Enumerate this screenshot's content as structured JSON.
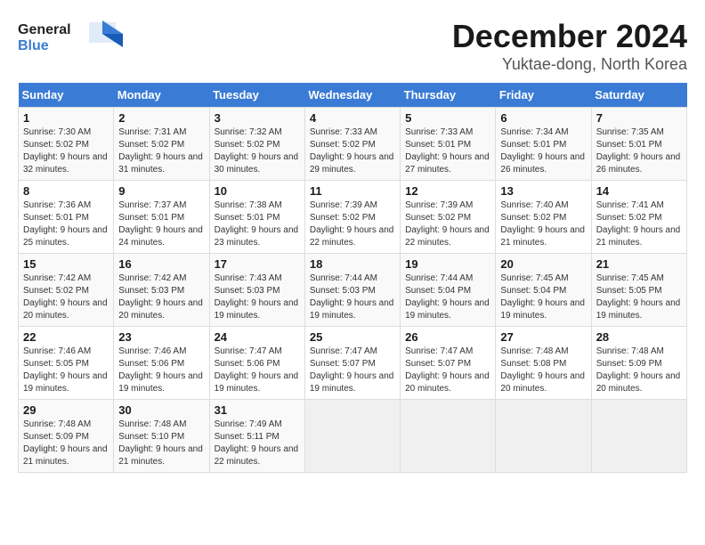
{
  "logo": {
    "line1": "General",
    "line2": "Blue"
  },
  "title": "December 2024",
  "subtitle": "Yuktae-dong, North Korea",
  "days_of_week": [
    "Sunday",
    "Monday",
    "Tuesday",
    "Wednesday",
    "Thursday",
    "Friday",
    "Saturday"
  ],
  "weeks": [
    [
      {
        "day": "1",
        "info": "Sunrise: 7:30 AM\nSunset: 5:02 PM\nDaylight: 9 hours and 32 minutes."
      },
      {
        "day": "2",
        "info": "Sunrise: 7:31 AM\nSunset: 5:02 PM\nDaylight: 9 hours and 31 minutes."
      },
      {
        "day": "3",
        "info": "Sunrise: 7:32 AM\nSunset: 5:02 PM\nDaylight: 9 hours and 30 minutes."
      },
      {
        "day": "4",
        "info": "Sunrise: 7:33 AM\nSunset: 5:02 PM\nDaylight: 9 hours and 29 minutes."
      },
      {
        "day": "5",
        "info": "Sunrise: 7:33 AM\nSunset: 5:01 PM\nDaylight: 9 hours and 27 minutes."
      },
      {
        "day": "6",
        "info": "Sunrise: 7:34 AM\nSunset: 5:01 PM\nDaylight: 9 hours and 26 minutes."
      },
      {
        "day": "7",
        "info": "Sunrise: 7:35 AM\nSunset: 5:01 PM\nDaylight: 9 hours and 26 minutes."
      }
    ],
    [
      {
        "day": "8",
        "info": "Sunrise: 7:36 AM\nSunset: 5:01 PM\nDaylight: 9 hours and 25 minutes."
      },
      {
        "day": "9",
        "info": "Sunrise: 7:37 AM\nSunset: 5:01 PM\nDaylight: 9 hours and 24 minutes."
      },
      {
        "day": "10",
        "info": "Sunrise: 7:38 AM\nSunset: 5:01 PM\nDaylight: 9 hours and 23 minutes."
      },
      {
        "day": "11",
        "info": "Sunrise: 7:39 AM\nSunset: 5:02 PM\nDaylight: 9 hours and 22 minutes."
      },
      {
        "day": "12",
        "info": "Sunrise: 7:39 AM\nSunset: 5:02 PM\nDaylight: 9 hours and 22 minutes."
      },
      {
        "day": "13",
        "info": "Sunrise: 7:40 AM\nSunset: 5:02 PM\nDaylight: 9 hours and 21 minutes."
      },
      {
        "day": "14",
        "info": "Sunrise: 7:41 AM\nSunset: 5:02 PM\nDaylight: 9 hours and 21 minutes."
      }
    ],
    [
      {
        "day": "15",
        "info": "Sunrise: 7:42 AM\nSunset: 5:02 PM\nDaylight: 9 hours and 20 minutes."
      },
      {
        "day": "16",
        "info": "Sunrise: 7:42 AM\nSunset: 5:03 PM\nDaylight: 9 hours and 20 minutes."
      },
      {
        "day": "17",
        "info": "Sunrise: 7:43 AM\nSunset: 5:03 PM\nDaylight: 9 hours and 19 minutes."
      },
      {
        "day": "18",
        "info": "Sunrise: 7:44 AM\nSunset: 5:03 PM\nDaylight: 9 hours and 19 minutes."
      },
      {
        "day": "19",
        "info": "Sunrise: 7:44 AM\nSunset: 5:04 PM\nDaylight: 9 hours and 19 minutes."
      },
      {
        "day": "20",
        "info": "Sunrise: 7:45 AM\nSunset: 5:04 PM\nDaylight: 9 hours and 19 minutes."
      },
      {
        "day": "21",
        "info": "Sunrise: 7:45 AM\nSunset: 5:05 PM\nDaylight: 9 hours and 19 minutes."
      }
    ],
    [
      {
        "day": "22",
        "info": "Sunrise: 7:46 AM\nSunset: 5:05 PM\nDaylight: 9 hours and 19 minutes."
      },
      {
        "day": "23",
        "info": "Sunrise: 7:46 AM\nSunset: 5:06 PM\nDaylight: 9 hours and 19 minutes."
      },
      {
        "day": "24",
        "info": "Sunrise: 7:47 AM\nSunset: 5:06 PM\nDaylight: 9 hours and 19 minutes."
      },
      {
        "day": "25",
        "info": "Sunrise: 7:47 AM\nSunset: 5:07 PM\nDaylight: 9 hours and 19 minutes."
      },
      {
        "day": "26",
        "info": "Sunrise: 7:47 AM\nSunset: 5:07 PM\nDaylight: 9 hours and 20 minutes."
      },
      {
        "day": "27",
        "info": "Sunrise: 7:48 AM\nSunset: 5:08 PM\nDaylight: 9 hours and 20 minutes."
      },
      {
        "day": "28",
        "info": "Sunrise: 7:48 AM\nSunset: 5:09 PM\nDaylight: 9 hours and 20 minutes."
      }
    ],
    [
      {
        "day": "29",
        "info": "Sunrise: 7:48 AM\nSunset: 5:09 PM\nDaylight: 9 hours and 21 minutes."
      },
      {
        "day": "30",
        "info": "Sunrise: 7:48 AM\nSunset: 5:10 PM\nDaylight: 9 hours and 21 minutes."
      },
      {
        "day": "31",
        "info": "Sunrise: 7:49 AM\nSunset: 5:11 PM\nDaylight: 9 hours and 22 minutes."
      },
      {
        "day": "",
        "info": ""
      },
      {
        "day": "",
        "info": ""
      },
      {
        "day": "",
        "info": ""
      },
      {
        "day": "",
        "info": ""
      }
    ]
  ]
}
